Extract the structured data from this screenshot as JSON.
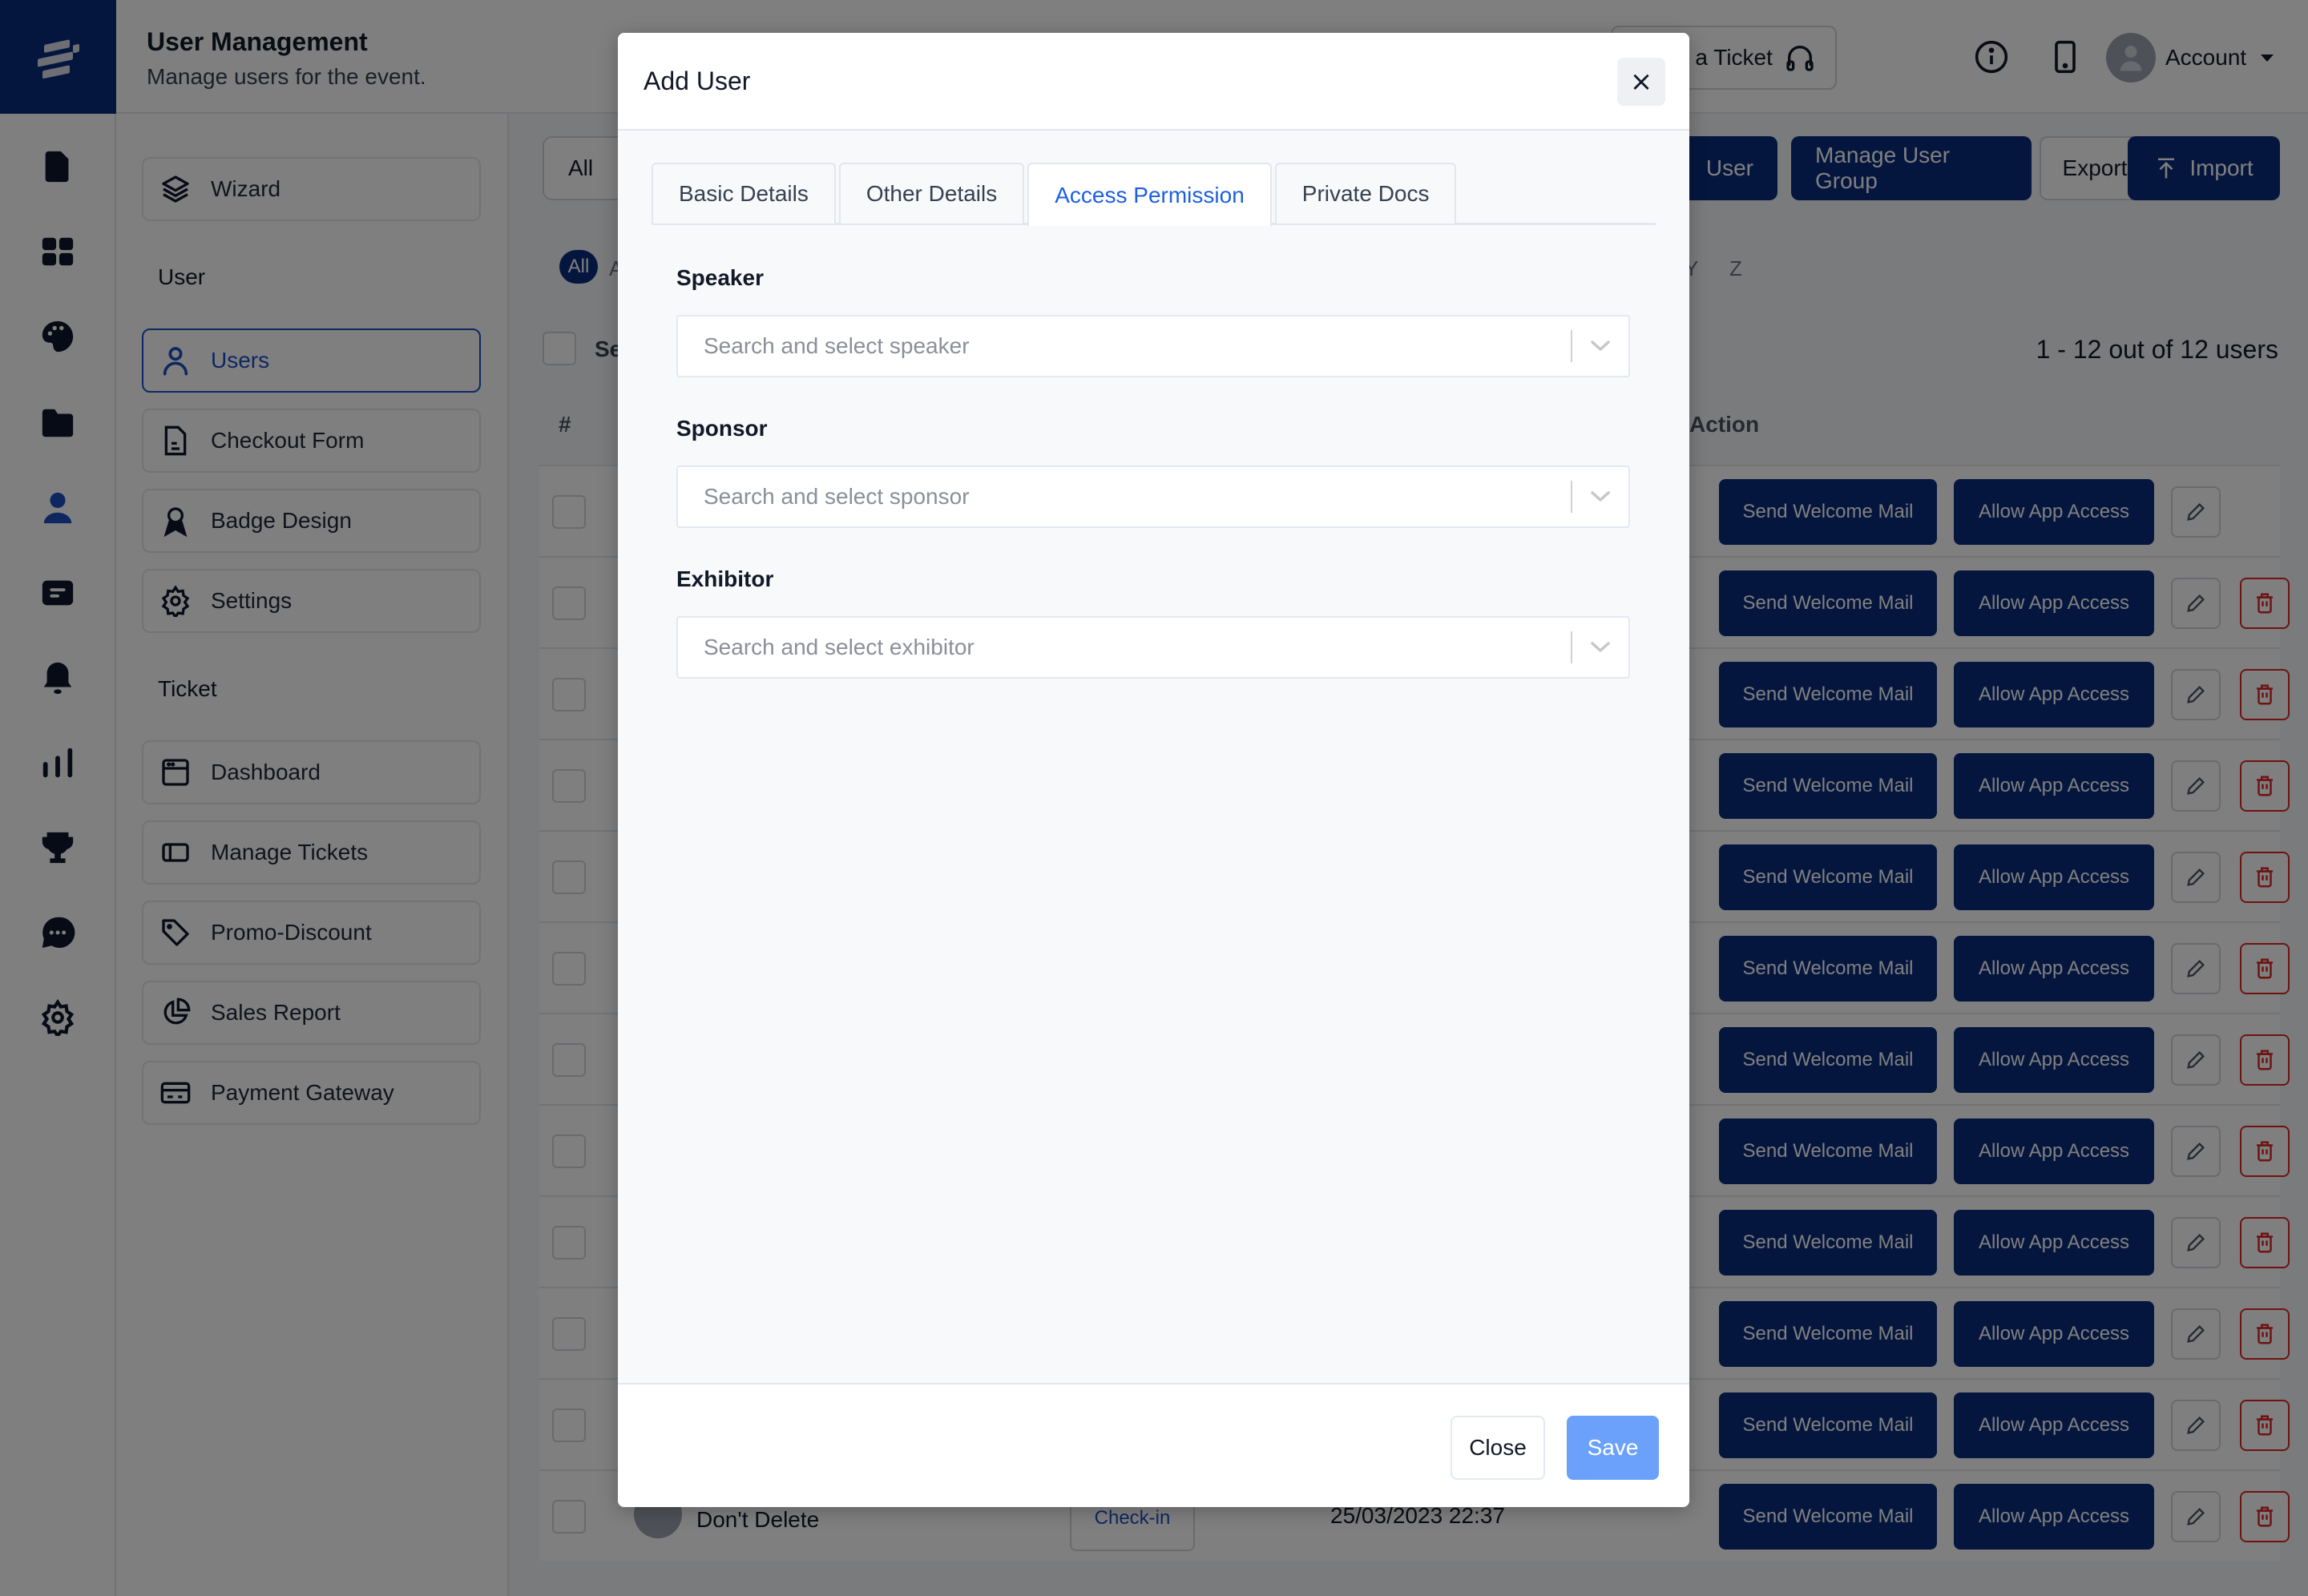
{
  "header": {
    "title": "User Management",
    "subtitle": "Manage users for the event.",
    "raise_ticket_label": "Raise a Ticket",
    "account_label": "Account"
  },
  "rail": {
    "icons": [
      "document-icon",
      "grid-icon",
      "palette-icon",
      "folder-icon",
      "user-icon",
      "message-card-icon",
      "bell-icon",
      "bar-chart-icon",
      "trophy-icon",
      "chat-icon",
      "gear-icon"
    ],
    "active": "user-icon"
  },
  "subnav": {
    "wizard_label": "Wizard",
    "user_section": "User",
    "user_items": [
      {
        "label": "Users",
        "icon": "user-outline-icon",
        "active": true
      },
      {
        "label": "Checkout Form",
        "icon": "file-text-icon",
        "active": false
      },
      {
        "label": "Badge Design",
        "icon": "award-icon",
        "active": false
      },
      {
        "label": "Settings",
        "icon": "gear-icon",
        "active": false
      }
    ],
    "ticket_section": "Ticket",
    "ticket_items": [
      {
        "label": "Dashboard",
        "icon": "browser-window-icon"
      },
      {
        "label": "Manage Tickets",
        "icon": "sidebar-layout-icon"
      },
      {
        "label": "Promo-Discount",
        "icon": "tag-icon"
      },
      {
        "label": "Sales Report",
        "icon": "pie-chart-icon"
      },
      {
        "label": "Payment Gateway",
        "icon": "credit-card-icon"
      }
    ]
  },
  "main": {
    "filter_value": "All",
    "toolbar": {
      "add_user_partial": "User",
      "manage_group": "Manage User Group",
      "export": "Export",
      "import": "Import"
    },
    "alphabet": {
      "all": "All",
      "first_partial": "A",
      "y": "Y",
      "z": "Z"
    },
    "select_partial": "Se",
    "count_text": "1 - 12 out of 12 users",
    "columns": {
      "index": "#",
      "action": "Action"
    },
    "row_actions": {
      "welcome": "Send Welcome Mail",
      "app_access": "Allow App Access"
    },
    "row_count": 12,
    "last_row": {
      "name": "Don't Delete",
      "status": "Check-in",
      "date": "25/03/2023 22:37"
    }
  },
  "modal": {
    "title": "Add User",
    "close_icon": "×",
    "tabs": [
      {
        "label": "Basic Details",
        "active": false
      },
      {
        "label": "Other Details",
        "active": false
      },
      {
        "label": "Access Permission",
        "active": true
      },
      {
        "label": "Private Docs",
        "active": false
      }
    ],
    "fields": [
      {
        "label": "Speaker",
        "placeholder": "Search and select speaker"
      },
      {
        "label": "Sponsor",
        "placeholder": "Search and select sponsor"
      },
      {
        "label": "Exhibitor",
        "placeholder": "Search and select exhibitor"
      }
    ],
    "close_label": "Close",
    "save_label": "Save"
  },
  "colors": {
    "brand": "#0a2d7d",
    "active_tab": "#1d5fe0",
    "save_disabled": "#6ba1fb",
    "danger": "#dc2626"
  }
}
